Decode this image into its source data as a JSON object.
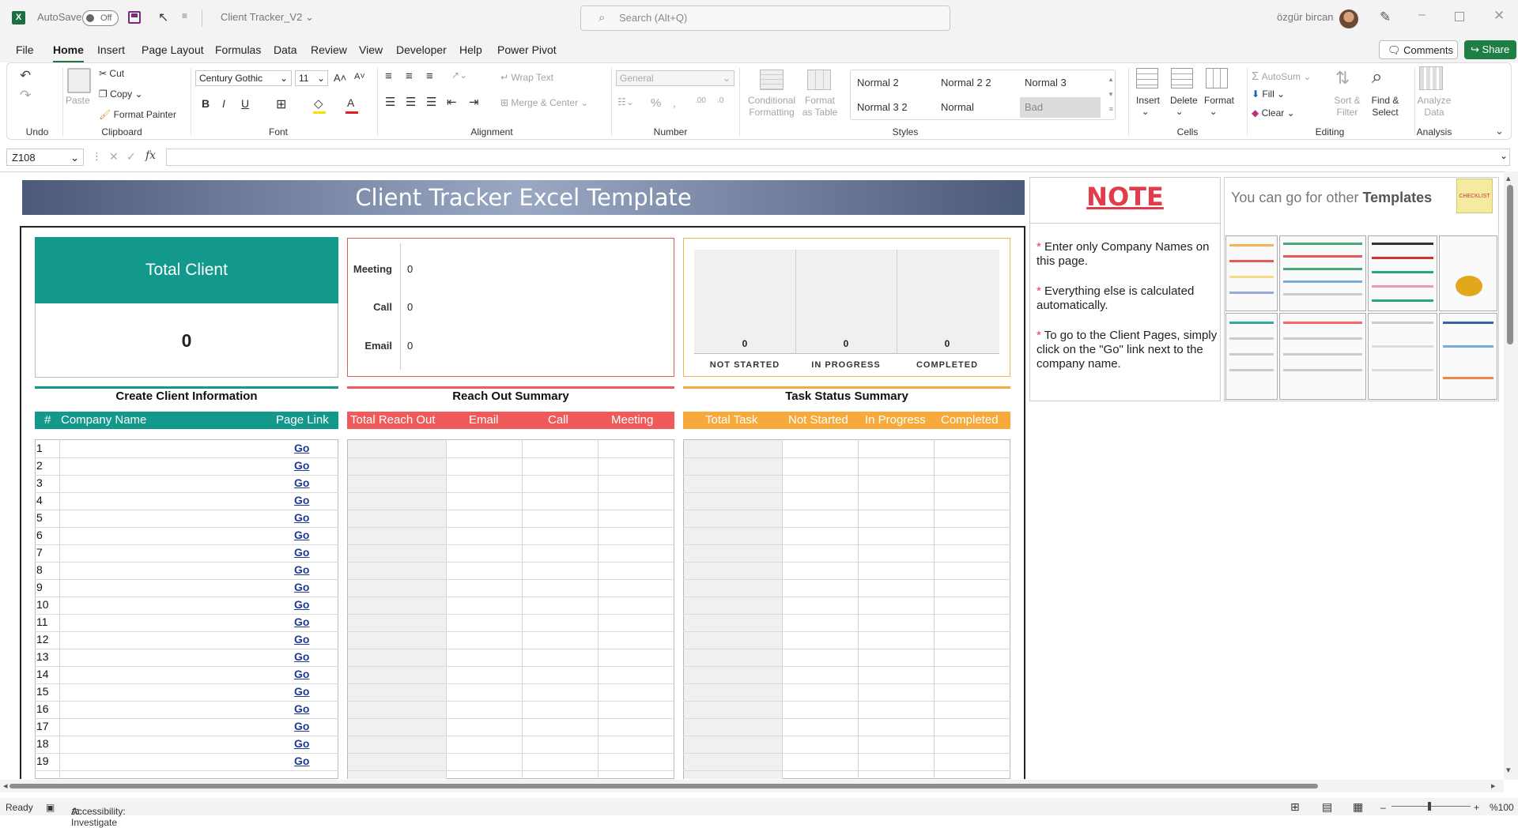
{
  "titlebar": {
    "autosave_label": "AutoSave",
    "autosave_state": "Off",
    "doc_title": "Client Tracker_V2",
    "search_placeholder": "Search (Alt+Q)",
    "user": "özgür bircan"
  },
  "menu": [
    "File",
    "Home",
    "Insert",
    "Page Layout",
    "Formulas",
    "Data",
    "Review",
    "View",
    "Developer",
    "Help",
    "Power Pivot"
  ],
  "menu_active": "Home",
  "comments_label": "Comments",
  "share_label": "Share",
  "ribbon": {
    "clipboard": {
      "paste": "Paste",
      "cut": "Cut",
      "copy": "Copy",
      "painter": "Format Painter",
      "group": "Clipboard"
    },
    "undo_group": "Undo",
    "font": {
      "name": "Century Gothic",
      "size": "11",
      "group": "Font"
    },
    "alignment": {
      "wrap": "Wrap Text",
      "merge": "Merge & Center",
      "group": "Alignment"
    },
    "number": {
      "format": "General",
      "group": "Number"
    },
    "styles": {
      "conditional": "Conditional Formatting",
      "format_table": "Format as Table",
      "cells": [
        "Normal 2",
        "Normal 2 2",
        "Normal 3",
        "Normal 3 2",
        "Normal",
        "Bad"
      ],
      "group": "Styles"
    },
    "cells": {
      "insert": "Insert",
      "delete": "Delete",
      "format": "Format",
      "group": "Cells"
    },
    "editing": {
      "autosum": "AutoSum",
      "fill": "Fill",
      "clear": "Clear",
      "sort": "Sort & Filter",
      "find": "Find & Select",
      "group": "Editing"
    },
    "analysis": {
      "analyze": "Analyze Data",
      "group": "Analysis"
    }
  },
  "formula_bar": {
    "name_box": "Z108",
    "fx": "fx",
    "value": ""
  },
  "sheet": {
    "banner_title": "Client Tracker Excel Template",
    "note": {
      "title": "NOTE",
      "items": [
        "Enter only Company Names on this page.",
        "Everything else is calculated automatically.",
        "To go to the Client Pages, simply click on the \"Go\" link next to the company name."
      ]
    },
    "templates": {
      "prefix": "You can go for other ",
      "bold": "Templates",
      "icon_text": "CHECKLIST"
    },
    "total_client": {
      "label": "Total Client",
      "value": "0"
    },
    "reach_card": [
      {
        "label": "Meeting",
        "value": "0"
      },
      {
        "label": "Call",
        "value": "0"
      },
      {
        "label": "Email",
        "value": "0"
      }
    ],
    "task_chart": {
      "values": [
        "0",
        "0",
        "0"
      ],
      "labels": [
        "NOT STARTED",
        "IN PROGRESS",
        "COMPLETED"
      ]
    },
    "sections": {
      "client": {
        "title": "Create Client Information",
        "cols": [
          "#",
          "Company Name",
          "Page Link"
        ]
      },
      "reach": {
        "title": "Reach Out Summary",
        "cols": [
          "Total Reach Out",
          "Email",
          "Call",
          "Meeting"
        ]
      },
      "task": {
        "title": "Task Status Summary",
        "cols": [
          "Total Task",
          "Not Started",
          "In Progress",
          "Completed"
        ]
      }
    },
    "rows": [
      "1",
      "2",
      "3",
      "4",
      "5",
      "6",
      "7",
      "8",
      "9",
      "10",
      "11",
      "12",
      "13",
      "14",
      "15",
      "16",
      "17",
      "18",
      "19"
    ],
    "go_label": "Go"
  },
  "status": {
    "ready": "Ready",
    "accessibility": "Accessibility: Investigate",
    "zoom": "%100"
  },
  "colors": {
    "excel_green": "#217346",
    "teal": "#13998c",
    "reach_red": "#f05a5a",
    "task_orange": "#f7a93b",
    "note_red": "#e23b4a"
  }
}
